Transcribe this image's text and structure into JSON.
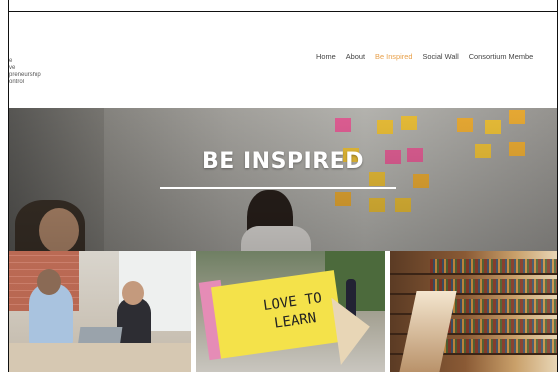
{
  "logo": {
    "lines": [
      "e",
      "ve",
      "preneurship",
      "ontrol"
    ]
  },
  "nav": {
    "items": [
      {
        "label": "Home",
        "active": false
      },
      {
        "label": "About",
        "active": false
      },
      {
        "label": "Be Inspired",
        "active": true
      },
      {
        "label": "Social Wall",
        "active": false
      },
      {
        "label": "Consortium Membe",
        "active": false
      }
    ],
    "active_color": "#e8a04a",
    "text_color": "#444444"
  },
  "hero": {
    "title": "BE INSPIRED"
  },
  "tiles": [
    {
      "name": "office-high-five"
    },
    {
      "name": "love-to-learn-pencil",
      "text_line1": "LOVE TO",
      "text_line2": "LEARN"
    },
    {
      "name": "library-bookshelves"
    }
  ]
}
